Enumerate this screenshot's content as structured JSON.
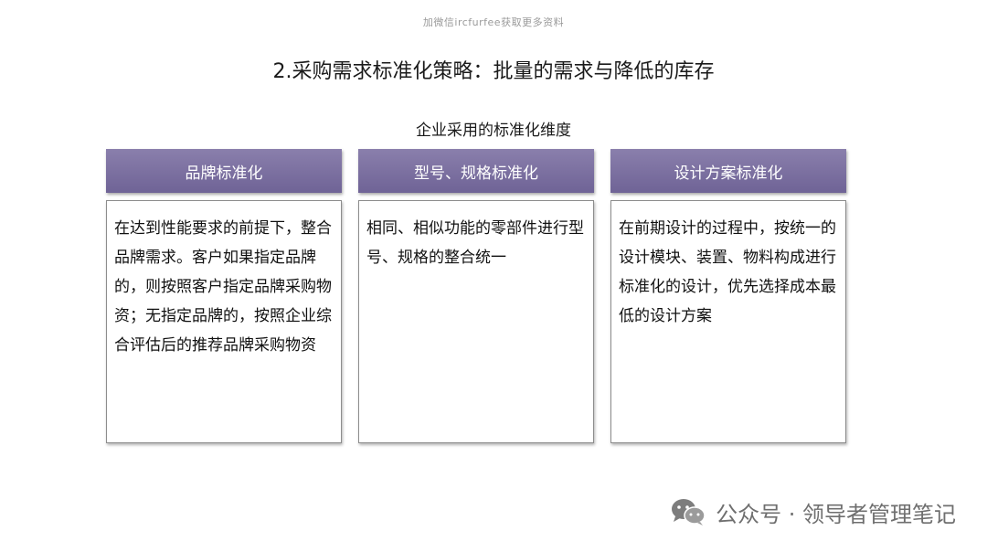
{
  "watermark": "加微信ircfurfee获取更多资料",
  "title": "2.采购需求标准化策略：批量的需求与降低的库存",
  "subtitle": "企业采用的标准化维度",
  "columns": [
    {
      "header": "品牌标准化",
      "body": "在达到性能要求的前提下，整合品牌需求。客户如果指定品牌的，则按照客户指定品牌采购物资；无指定品牌的，按照企业综合评估后的推荐品牌采购物资"
    },
    {
      "header": "型号、规格标准化",
      "body": "相同、相似功能的零部件进行型号、规格的整合统一"
    },
    {
      "header": "设计方案标准化",
      "body": "在前期设计的过程中，按统一的设计模块、装置、物料构成进行标准化的设计，优先选择成本最低的设计方案"
    }
  ],
  "footer": {
    "text": "公众号 · 领导者管理笔记",
    "icon": "wechat-icon"
  },
  "colors": {
    "header_bg": "#7a6fa0",
    "header_text": "#ffffff",
    "border": "#8c8c8c"
  }
}
